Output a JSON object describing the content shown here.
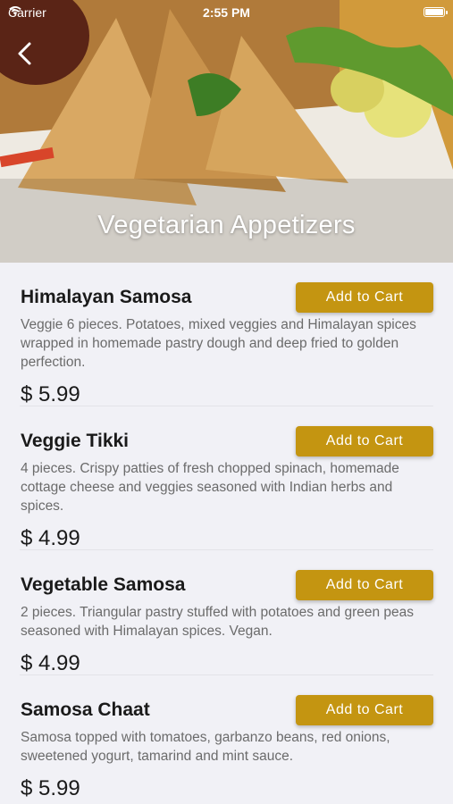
{
  "status_bar": {
    "carrier": "Carrier",
    "time": "2:55 PM"
  },
  "header": {
    "title": "Vegetarian Appetizers",
    "back_icon": "chevron-left-icon"
  },
  "menu": {
    "items": [
      {
        "name": "Himalayan Samosa",
        "description": "Veggie 6 pieces. Potatoes, mixed veggies and Himalayan spices wrapped in homemade pastry dough and deep fried to golden perfection.",
        "price": "$ 5.99",
        "button": "Add to Cart"
      },
      {
        "name": "Veggie Tikki",
        "description": "4 pieces. Crispy patties of fresh chopped spinach, homemade cottage cheese and veggies seasoned with Indian herbs and spices.",
        "price": "$ 4.99",
        "button": "Add to Cart"
      },
      {
        "name": "Vegetable Samosa",
        "description": "2 pieces. Triangular pastry stuffed with potatoes and green peas seasoned with Himalayan spices. Vegan.",
        "price": "$ 4.99",
        "button": "Add to Cart"
      },
      {
        "name": "Samosa Chaat",
        "description": "Samosa topped with tomatoes, garbanzo beans, red onions, sweetened yogurt, tamarind and mint sauce.",
        "price": "$ 5.99",
        "button": "Add to Cart"
      }
    ]
  },
  "colors": {
    "accent": "#c49511",
    "background": "#f1f1f6"
  }
}
